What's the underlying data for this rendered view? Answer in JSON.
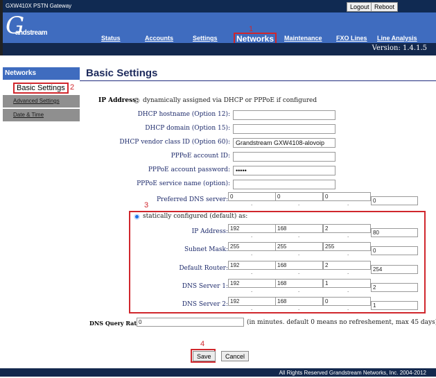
{
  "header": {
    "title": "GXW410X PSTN Gateway",
    "logout": "Logout",
    "reboot": "Reboot",
    "logo": "Grandstream",
    "version": "Version: 1.4.1.5"
  },
  "nav": [
    {
      "label": "Status"
    },
    {
      "label": "Accounts"
    },
    {
      "label": "Settings"
    },
    {
      "label": "Networks"
    },
    {
      "label": "Maintenance"
    },
    {
      "label": "FXO Lines"
    },
    {
      "label": "Line Analysis"
    }
  ],
  "annotations": [
    "1",
    "2",
    "3",
    "4"
  ],
  "sidebar": {
    "header": "Networks",
    "items": [
      {
        "label": "Basic Settings"
      },
      {
        "label": "Advanced Settings"
      },
      {
        "label": "Date & Time"
      }
    ]
  },
  "page_title": "Basic Settings",
  "form": {
    "ip_label": "IP Address:",
    "dhcp_option": "dynamically assigned via DHCP or PPPoE if configured",
    "fields": [
      {
        "label": "DHCP hostname (Option 12):",
        "value": ""
      },
      {
        "label": "DHCP domain (Option 15):",
        "value": ""
      },
      {
        "label": "DHCP vendor class ID (Option 60):",
        "value": "Grandstream GXW4108-alovoip"
      },
      {
        "label": "PPPoE account ID:",
        "value": ""
      },
      {
        "label": "PPPoE account password:",
        "value": "•••••"
      },
      {
        "label": "PPPoE service name (option):",
        "value": ""
      }
    ],
    "preferred_dns": {
      "label": "Preferred DNS server:",
      "octets": [
        "0",
        "0",
        "0",
        "0"
      ]
    },
    "static_option": "statically configured (default) as:",
    "static": [
      {
        "label": "IP Address:",
        "octets": [
          "192",
          "168",
          "2",
          "80"
        ]
      },
      {
        "label": "Subnet Mask:",
        "octets": [
          "255",
          "255",
          "255",
          "0"
        ]
      },
      {
        "label": "Default Router:",
        "octets": [
          "192",
          "168",
          "2",
          "254"
        ]
      },
      {
        "label": "DNS Server 1:",
        "octets": [
          "192",
          "168",
          "1",
          "2"
        ]
      },
      {
        "label": "DNS Server 2:",
        "octets": [
          "192",
          "168",
          "0",
          "1"
        ]
      }
    ],
    "dns_rate": {
      "label": "DNS Query Rate:",
      "value": "0",
      "hint": "(in minutes. default 0 means no refreshement, max 45 days)"
    },
    "save": "Save",
    "cancel": "Cancel"
  },
  "footer": "All Rights Reserved Grandstream Networks, Inc. 2004-2012"
}
